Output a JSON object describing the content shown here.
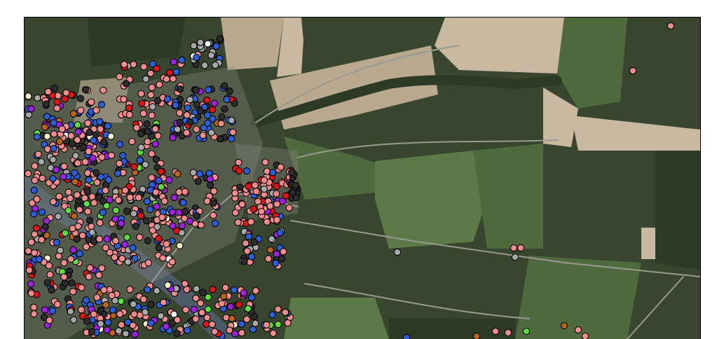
{
  "map": {
    "kind": "aerial-orthophoto",
    "title": "",
    "frame_border_color": "#000000",
    "land_cover_colors": {
      "dark_field": "#38452f",
      "green_field": "#4f6b3e",
      "meadow": "#5c7a48",
      "bare_field": "#b9a98f",
      "light_field": "#c8b9a0",
      "forest": "#2a3a24",
      "river": "#4b5b68",
      "settlement": "#8a8a80",
      "road": "#9a9a90"
    },
    "point_categories": [
      {
        "id": "salmon",
        "color": "#f28c8c"
      },
      {
        "id": "blue",
        "color": "#2b5fd9"
      },
      {
        "id": "dark",
        "color": "#2c2c2c"
      },
      {
        "id": "grey",
        "color": "#a8a8a8"
      },
      {
        "id": "purple",
        "color": "#a020e0"
      },
      {
        "id": "red",
        "color": "#e01414"
      },
      {
        "id": "brown",
        "color": "#b8641a"
      },
      {
        "id": "green",
        "color": "#5ae03a"
      },
      {
        "id": "cream",
        "color": "#f5f0c8"
      },
      {
        "id": "white",
        "color": "#f5f5f5"
      }
    ],
    "point_outline_color": "#000000"
  }
}
